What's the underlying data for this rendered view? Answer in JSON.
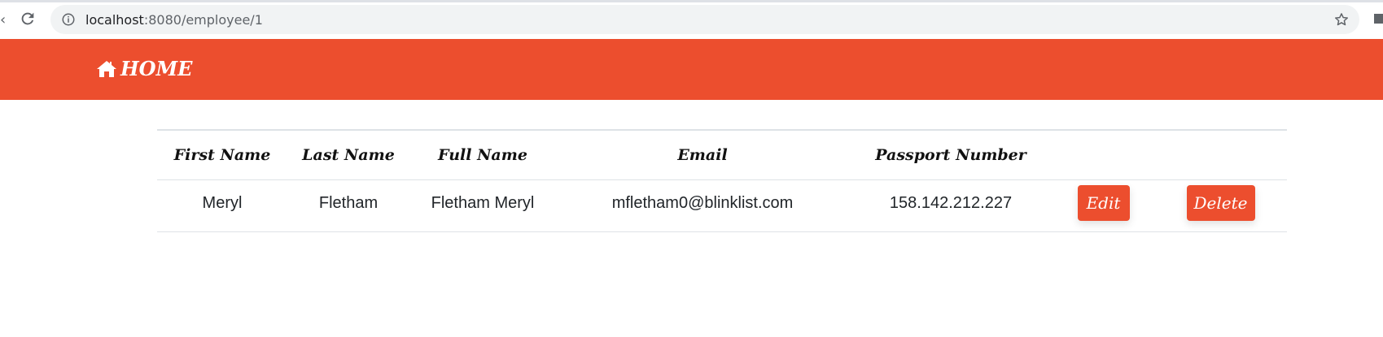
{
  "browser": {
    "url_host": "localhost",
    "url_path": ":8080/employee/1"
  },
  "navbar": {
    "brand_label": "HOME",
    "brand_icon": "home-icon",
    "color": "#ec4e2e"
  },
  "table": {
    "columns": [
      "First Name",
      "Last Name",
      "Full Name",
      "Email",
      "Passport Number",
      "",
      ""
    ],
    "rows": [
      {
        "first_name": "Meryl",
        "last_name": "Fletham",
        "full_name": "Fletham Meryl",
        "email": "mfletham0@blinklist.com",
        "passport_number": "158.142.212.227",
        "edit_label": "Edit",
        "delete_label": "Delete"
      }
    ]
  }
}
